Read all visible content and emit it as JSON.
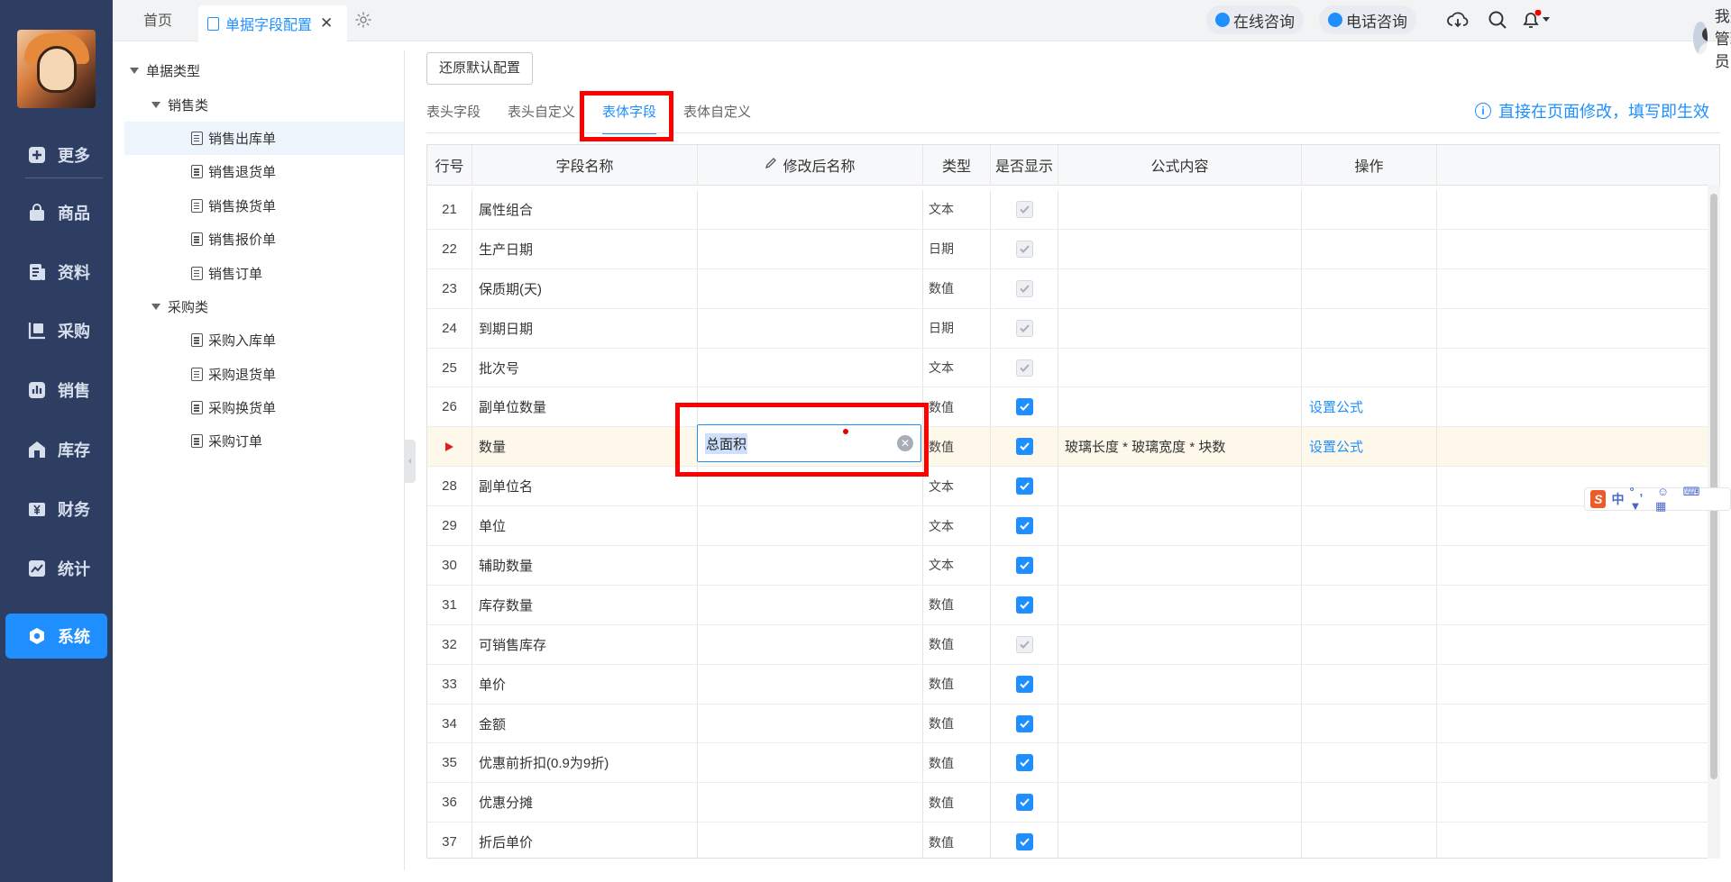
{
  "nav": {
    "items": [
      {
        "label": "更多",
        "icon": "plus-square-icon"
      },
      {
        "label": "商品",
        "icon": "bag-icon"
      },
      {
        "label": "资料",
        "icon": "document-icon"
      },
      {
        "label": "采购",
        "icon": "purchase-icon"
      },
      {
        "label": "销售",
        "icon": "bar-chart-icon"
      },
      {
        "label": "库存",
        "icon": "warehouse-icon"
      },
      {
        "label": "财务",
        "icon": "yen-icon"
      },
      {
        "label": "统计",
        "icon": "trend-chart-icon"
      },
      {
        "label": "系统",
        "icon": "system-hex-icon",
        "active": true
      }
    ]
  },
  "topbar": {
    "home_tab": "首页",
    "active_tab": "单据字段配置",
    "online_consult": "在线咨询",
    "phone_consult": "电话咨询",
    "username": "我是管理员"
  },
  "tree": {
    "root": "单据类型",
    "groups": [
      {
        "label": "销售类",
        "items": [
          "销售出库单",
          "销售退货单",
          "销售换货单",
          "销售报价单",
          "销售订单"
        ]
      },
      {
        "label": "采购类",
        "items": [
          "采购入库单",
          "采购退货单",
          "采购换货单",
          "采购订单"
        ]
      }
    ],
    "selected": "销售出库单"
  },
  "main": {
    "restore_button": "还原默认配置",
    "subtabs": [
      "表头字段",
      "表头自定义",
      "表体字段",
      "表体自定义"
    ],
    "active_subtab": "表体字段",
    "hint": "直接在页面修改，填写即生效"
  },
  "grid": {
    "columns": [
      "行号",
      "字段名称",
      "修改后名称",
      "类型",
      "是否显示",
      "公式内容",
      "操作"
    ],
    "rows": [
      {
        "no": "21",
        "name": "属性组合",
        "rename": "",
        "type": "文本",
        "show": "disabled",
        "formula": "",
        "op": ""
      },
      {
        "no": "22",
        "name": "生产日期",
        "rename": "",
        "type": "日期",
        "show": "disabled",
        "formula": "",
        "op": ""
      },
      {
        "no": "23",
        "name": "保质期(天)",
        "rename": "",
        "type": "数值",
        "show": "disabled",
        "formula": "",
        "op": ""
      },
      {
        "no": "24",
        "name": "到期日期",
        "rename": "",
        "type": "日期",
        "show": "disabled",
        "formula": "",
        "op": ""
      },
      {
        "no": "25",
        "name": "批次号",
        "rename": "",
        "type": "文本",
        "show": "disabled",
        "formula": "",
        "op": ""
      },
      {
        "no": "26",
        "name": "副单位数量",
        "rename": "",
        "type": "数值",
        "show": "checked",
        "formula": "",
        "op": "设置公式"
      },
      {
        "no": "",
        "name": "数量",
        "rename": "总面积",
        "type": "数值",
        "show": "checked",
        "formula": "玻璃长度 * 玻璃宽度 * 块数",
        "op": "设置公式",
        "current": true
      },
      {
        "no": "28",
        "name": "副单位名",
        "rename": "",
        "type": "文本",
        "show": "checked",
        "formula": "",
        "op": ""
      },
      {
        "no": "29",
        "name": "单位",
        "rename": "",
        "type": "文本",
        "show": "checked",
        "formula": "",
        "op": ""
      },
      {
        "no": "30",
        "name": "辅助数量",
        "rename": "",
        "type": "文本",
        "show": "checked",
        "formula": "",
        "op": ""
      },
      {
        "no": "31",
        "name": "库存数量",
        "rename": "",
        "type": "数值",
        "show": "checked",
        "formula": "",
        "op": ""
      },
      {
        "no": "32",
        "name": "可销售库存",
        "rename": "",
        "type": "数值",
        "show": "disabled",
        "formula": "",
        "op": ""
      },
      {
        "no": "33",
        "name": "单价",
        "rename": "",
        "type": "数值",
        "show": "checked",
        "formula": "",
        "op": ""
      },
      {
        "no": "34",
        "name": "金额",
        "rename": "",
        "type": "数值",
        "show": "checked",
        "formula": "",
        "op": ""
      },
      {
        "no": "35",
        "name": "优惠前折扣(0.9为9折)",
        "rename": "",
        "type": "数值",
        "show": "checked",
        "formula": "",
        "op": ""
      },
      {
        "no": "36",
        "name": "优惠分摊",
        "rename": "",
        "type": "数值",
        "show": "checked",
        "formula": "",
        "op": ""
      },
      {
        "no": "37",
        "name": "折后单价",
        "rename": "",
        "type": "数值",
        "show": "checked",
        "formula": "",
        "op": ""
      }
    ]
  },
  "ime_toolbar": {
    "label": "中"
  },
  "colors": {
    "nav_bg": "#2e3e62",
    "accent": "#1f8fff",
    "highlight_box": "#ff0000",
    "current_row": "#fdf8ea"
  }
}
